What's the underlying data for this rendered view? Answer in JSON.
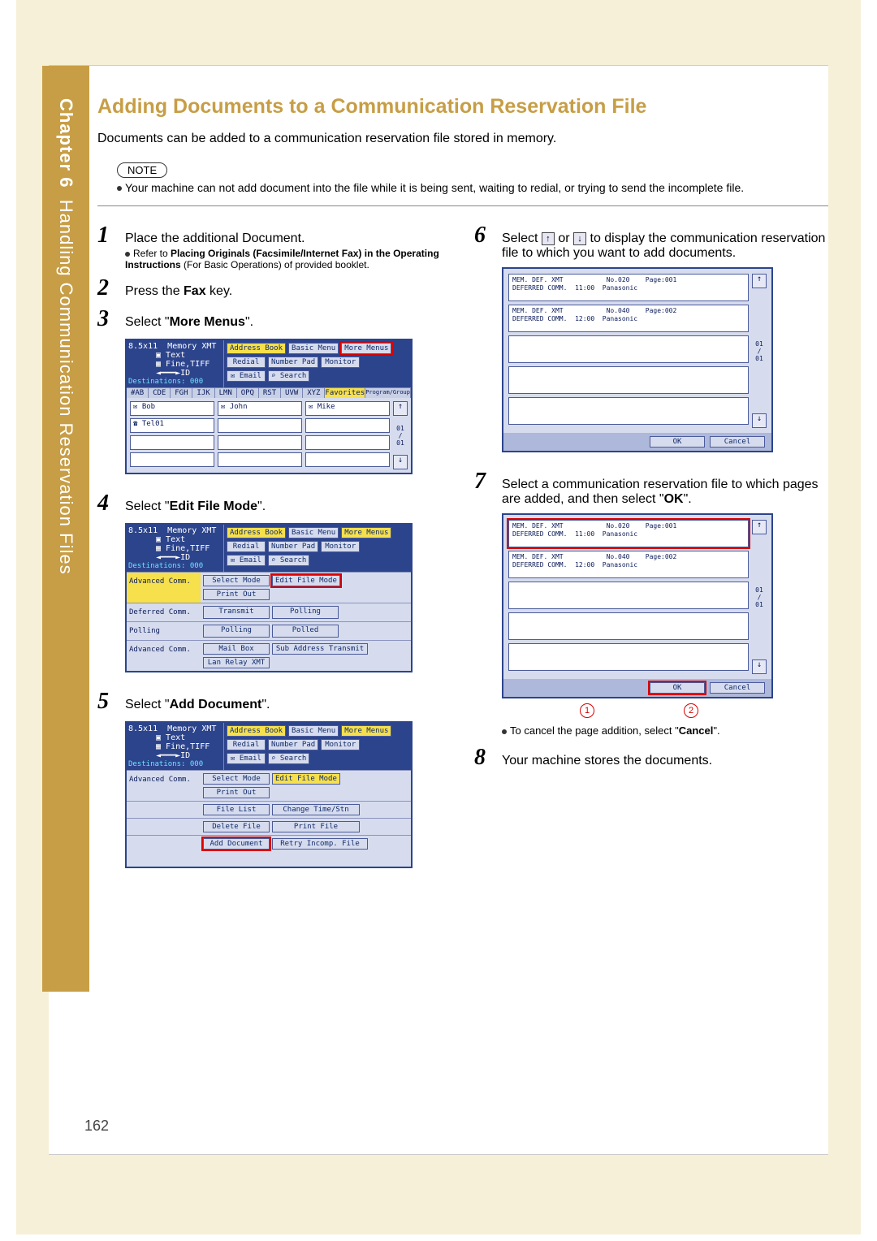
{
  "sidebar": {
    "chapter_label": "Chapter 6",
    "title": "Handling Communication Reservation Files"
  },
  "heading": "Adding Documents to a Communication Reservation File",
  "intro": "Documents can be added to a communication reservation file stored in memory.",
  "note_label": "NOTE",
  "note_text": "Your machine can not add document into the file while it is being sent, waiting to redial, or trying to send the incomplete file.",
  "page_number": "162",
  "steps": {
    "s1": {
      "text": "Place the additional Document.",
      "sub_a": "Refer to ",
      "sub_b_bold": "Placing Originals (Facsimile/Internet Fax) in the Operating Instructions",
      "sub_c": " (For Basic Operations) of provided booklet."
    },
    "s2": {
      "pre": "Press the ",
      "bold": "Fax",
      "post": " key."
    },
    "s3": {
      "pre": "Select \"",
      "bold": "More Menus",
      "post": "\"."
    },
    "s4": {
      "pre": "Select \"",
      "bold": "Edit File Mode",
      "post": "\"."
    },
    "s5": {
      "pre": "Select \"",
      "bold": "Add Document",
      "post": "\"."
    },
    "s6": {
      "pre": "Select ",
      "mid": " or ",
      "post": " to display the communication reservation file to which you want to add documents."
    },
    "s7": {
      "text_a": "Select a communication reservation file to which pages are added, and then select \"",
      "bold": "OK",
      "text_b": "\".",
      "sub_a": "To cancel the page addition, select \"",
      "sub_bold": "Cancel",
      "sub_b": "\"."
    },
    "s8": {
      "text": "Your machine stores the documents."
    }
  },
  "screen_common": {
    "size": "8.5x11",
    "memory": "Memory XMT",
    "text_line": "Text",
    "fine_line": "Fine,TIFF",
    "dest": "Destinations: 000",
    "btns": {
      "address_book": "Address Book",
      "basic_menu": "Basic Menu",
      "more_menus": "More Menus",
      "redial": "Redial",
      "number_pad": "Number Pad",
      "monitor": "Monitor",
      "email": "Email",
      "search": "Search"
    },
    "tabs": [
      "#AB",
      "CDE",
      "FGH",
      "IJK",
      "LMN",
      "OPQ",
      "RST",
      "UVW",
      "XYZ",
      "Favorites",
      "Program/Group"
    ],
    "contacts": {
      "bob": "Bob",
      "john": "John",
      "mike": "Mike",
      "tel01": "Tel01"
    },
    "scroll_info": "01\n/\n01"
  },
  "screen4": {
    "rows": {
      "adv_comm": "Advanced Comm.",
      "select_mode": "Select Mode",
      "edit_file_mode": "Edit File Mode",
      "print_out": "Print Out",
      "deferred": "Deferred Comm.",
      "transmit": "Transmit",
      "polling_hdr": "Polling",
      "polling": "Polling",
      "polled": "Polled",
      "mail_box": "Mail Box",
      "sub_addr": "Sub Address Transmit",
      "lan_relay": "Lan Relay XMT"
    }
  },
  "screen5": {
    "rows": {
      "adv_comm": "Advanced Comm.",
      "select_mode": "Select Mode",
      "edit_file_mode": "Edit File Mode",
      "print_out": "Print Out",
      "file_list": "File List",
      "change_time": "Change Time/Stn",
      "delete_file": "Delete File",
      "print_file": "Print File",
      "add_document": "Add Document",
      "retry": "Retry Incomp. File"
    }
  },
  "filescreen": {
    "row1": "MEM. DEF. XMT           No.020    Page:001\nDEFERRED COMM.  11:00  Panasonic",
    "row2": "MEM. DEF. XMT           No.040    Page:002\nDEFERRED COMM.  12:00  Panasonic",
    "ok": "OK",
    "cancel": "Cancel"
  },
  "annotations": {
    "one": "1",
    "two": "2"
  }
}
